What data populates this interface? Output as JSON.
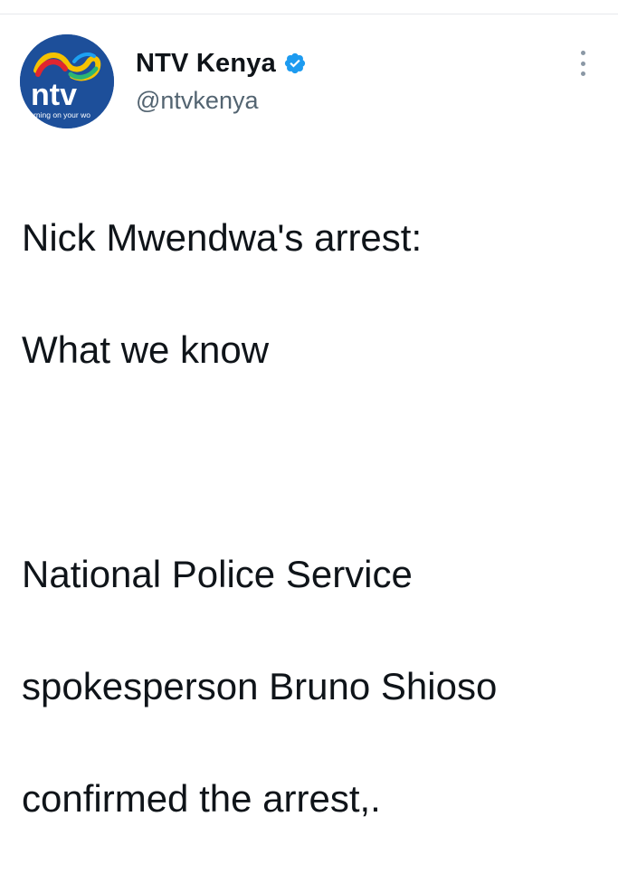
{
  "tweet": {
    "author": {
      "display_name": "NTV Kenya",
      "handle": "@ntvkenya",
      "verified": true,
      "avatar": {
        "logo_text": "ntv",
        "tagline": "turning on your world",
        "background_color": "#1d4f9a"
      }
    },
    "text_lines": {
      "line1": "Nick Mwendwa's arrest:",
      "line2": "What we know",
      "line3": "",
      "line4": "National Police Service",
      "line5": "spokesperson Bruno Shioso",
      "line6": "confirmed the arrest,."
    },
    "icons": {
      "verified": "verified-badge-icon",
      "more": "more-options-icon"
    },
    "colors": {
      "verified_blue": "#1d9bf0",
      "text": "#0f1419",
      "secondary_text": "#536471"
    }
  }
}
